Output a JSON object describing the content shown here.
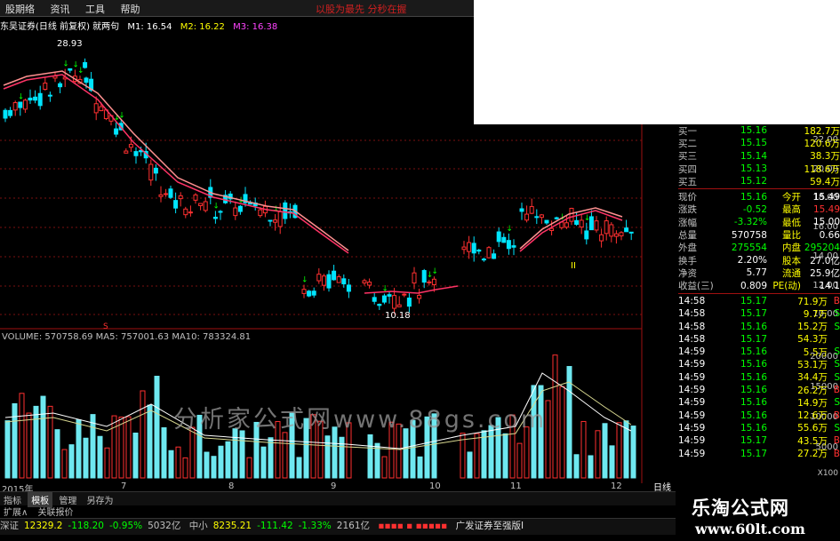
{
  "menu": {
    "items": [
      "股期络",
      "资讯",
      "工具",
      "帮助"
    ],
    "promo": "以股为最先  分秒在握"
  },
  "chart_header": {
    "title": "东吴证券(日线 前复权) 就两句",
    "m1": "M1: 16.54",
    "m2": "M2: 16.22",
    "m3": "M3: 16.38"
  },
  "annotations": {
    "high": "28.93",
    "low": "10.18",
    "marker_s": "S",
    "marker_ii": "II"
  },
  "price_axis": {
    "ticks": [
      "22.00",
      "20.00",
      "18.00",
      "16.00",
      "14.00",
      "12.00",
      "10.00"
    ]
  },
  "volume_header": "VOLUME: 570758.69  MA5: 757001.63  MA10: 783324.81",
  "volume_axis": {
    "ticks": [
      "20000",
      "15000",
      "10000",
      "5000"
    ],
    "unit": "X100"
  },
  "x_axis": {
    "ticks": [
      "2015年",
      "7",
      "8",
      "9",
      "10",
      "11",
      "12"
    ]
  },
  "quote": {
    "bids": [
      {
        "label": "买一",
        "price": "15.16",
        "vol": "182.7万"
      },
      {
        "label": "买二",
        "price": "15.15",
        "vol": "120.6万"
      },
      {
        "label": "买三",
        "price": "15.14",
        "vol": "38.3万"
      },
      {
        "label": "买四",
        "price": "15.13",
        "vol": "118.6万"
      },
      {
        "label": "买五",
        "price": "15.12",
        "vol": "59.4万"
      }
    ],
    "stats": [
      {
        "l1": "现价",
        "v1": "15.16",
        "l2": "今开",
        "v2": "15.49"
      },
      {
        "l1": "涨跌",
        "v1": "-0.52",
        "l2": "最高",
        "v2": "15.49"
      },
      {
        "l1": "涨幅",
        "v1": "-3.32%",
        "l2": "最低",
        "v2": "15.00"
      },
      {
        "l1": "总量",
        "v1": "570758",
        "l2": "量比",
        "v2": "0.66"
      },
      {
        "l1": "外盘",
        "v1": "275554",
        "l2": "内盘",
        "v2": "295204"
      },
      {
        "l1": "换手",
        "v1": "2.20%",
        "l2": "股本",
        "v2": "27.0亿"
      },
      {
        "l1": "净资",
        "v1": "5.77",
        "l2": "流通",
        "v2": "25.9亿"
      },
      {
        "l1": "收益(三)",
        "v1": "0.809",
        "l2": "PE(动)",
        "v2": "14.1"
      }
    ],
    "ticks": [
      {
        "time": "14:58",
        "price": "15.17",
        "vol": "71.9万",
        "side": "B"
      },
      {
        "time": "14:58",
        "price": "15.17",
        "vol": "9.7万",
        "side": "S"
      },
      {
        "time": "14:58",
        "price": "15.16",
        "vol": "15.2万",
        "side": "S"
      },
      {
        "time": "14:58",
        "price": "15.17",
        "vol": "54.3万",
        "side": ""
      },
      {
        "time": "14:59",
        "price": "15.16",
        "vol": "5.5万",
        "side": "S"
      },
      {
        "time": "14:59",
        "price": "15.16",
        "vol": "53.1万",
        "side": "S"
      },
      {
        "time": "14:59",
        "price": "15.16",
        "vol": "34.4万",
        "side": "S"
      },
      {
        "time": "14:59",
        "price": "15.16",
        "vol": "26.2万",
        "side": "B"
      },
      {
        "time": "14:59",
        "price": "15.16",
        "vol": "14.9万",
        "side": "S"
      },
      {
        "time": "14:59",
        "price": "15.16",
        "vol": "12.6万",
        "side": "B"
      },
      {
        "time": "14:59",
        "price": "15.16",
        "vol": "55.6万",
        "side": "S"
      },
      {
        "time": "14:59",
        "price": "15.17",
        "vol": "43.5万",
        "side": "B"
      },
      {
        "time": "14:59",
        "price": "15.17",
        "vol": "27.2万",
        "side": "B"
      }
    ],
    "day_tab": "日线"
  },
  "tabs": [
    "指标",
    "模板",
    "管理",
    "另存为"
  ],
  "subtabs": [
    "扩展∧",
    "关联报价"
  ],
  "status": {
    "sz": "深证",
    "sz_val": "12329.2",
    "sz_chg": "-118.20",
    "sz_pct": "-0.95%",
    "sz_amt": "5032亿",
    "zx": "中小",
    "zx_val": "8235.21",
    "zx_chg": "-111.42",
    "zx_pct": "-1.33%",
    "zx_amt": "2161亿",
    "broker": "广发证券至强版I"
  },
  "brand": {
    "title": "乐淘公式网",
    "url": "www.60lt.com"
  },
  "watermark": "分析家公式网www.88gs.com",
  "colors": {
    "up": "#ff3030",
    "down": "#00e5ff",
    "ma_long": "#ff3366",
    "ma_short": "#ff9090",
    "buy_arrow": "#00ff00"
  }
}
